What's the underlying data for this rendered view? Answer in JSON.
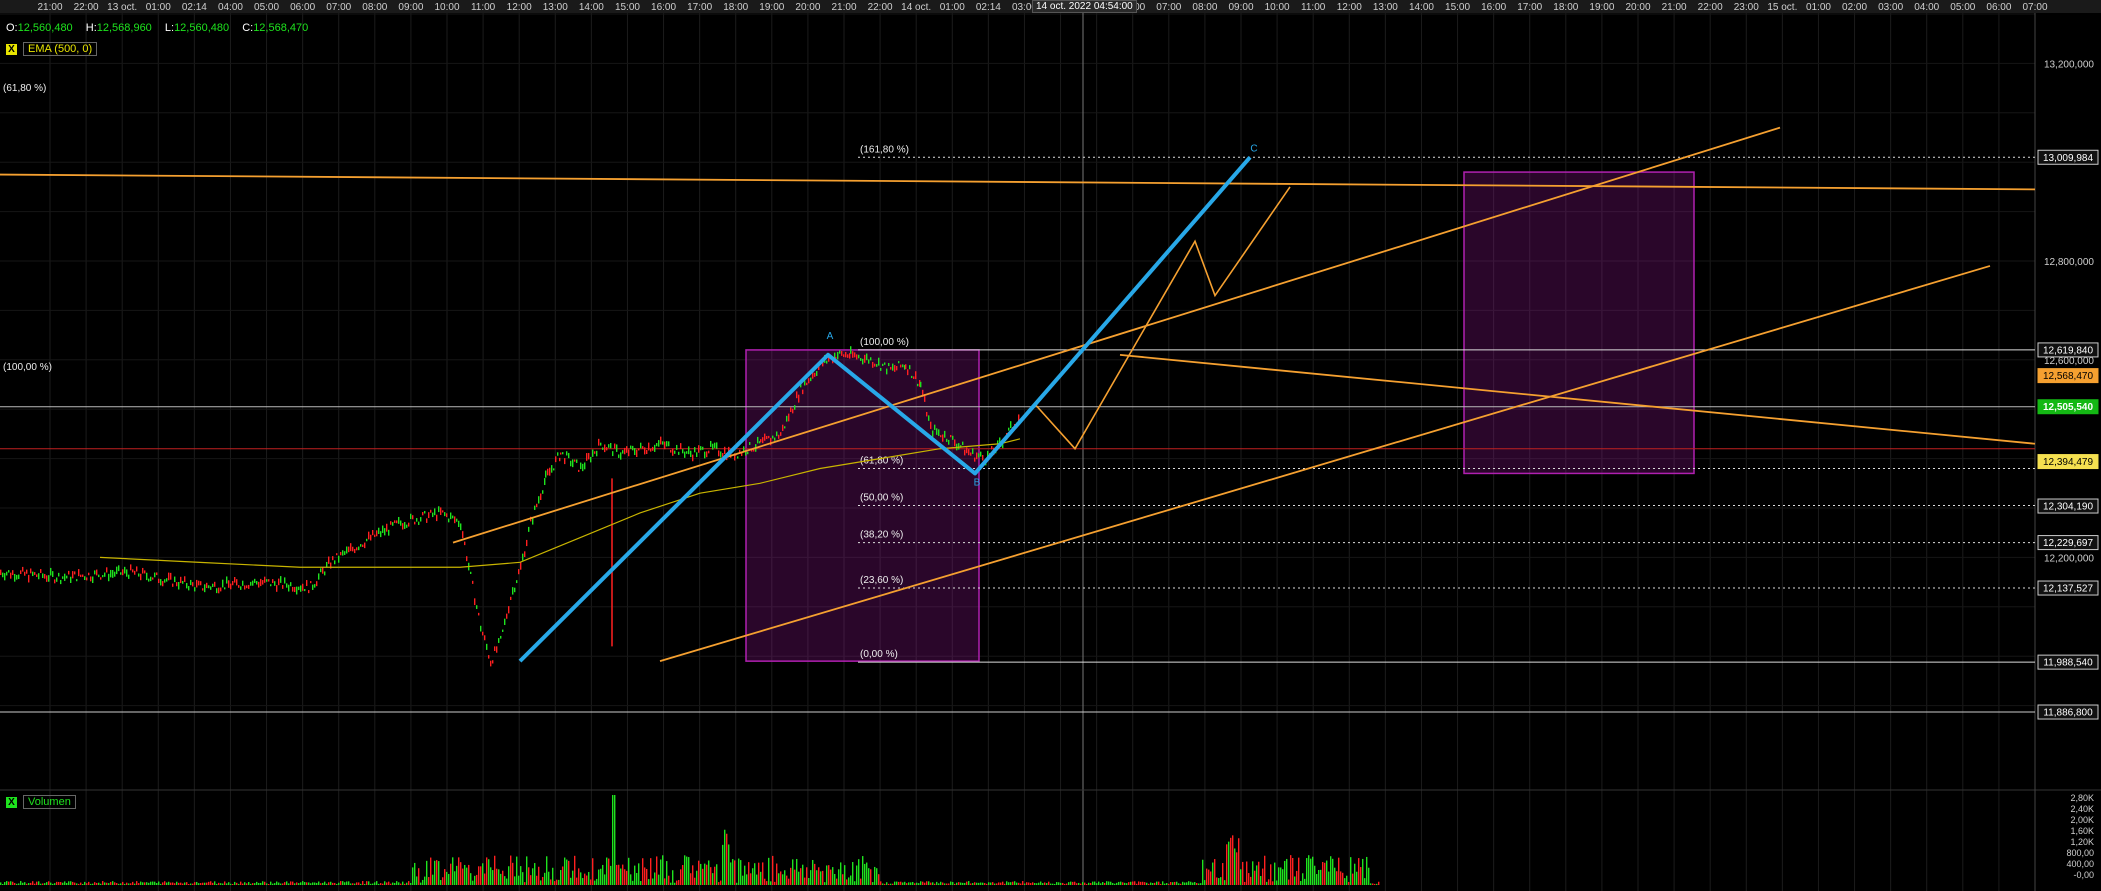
{
  "ohlc": {
    "open_label": "O:",
    "open": "12,560,480",
    "high_label": "H:",
    "high": "12,568,960",
    "low_label": "L:",
    "low": "12,560,480",
    "close_label": "C:",
    "close": "12,568,470"
  },
  "indicator": {
    "toggle": "X",
    "label": "EMA (500, 0)"
  },
  "volume_indicator": {
    "toggle": "X",
    "label": "Volumen"
  },
  "cursor_time": "14 oct. 2022 04:54:00",
  "chart_data": {
    "type": "line",
    "time_ticks": [
      "21:00",
      "22:00",
      "13 oct.",
      "01:00",
      "02:14",
      "04:00",
      "05:00",
      "06:00",
      "07:00",
      "08:00",
      "09:00",
      "10:00",
      "11:00",
      "12:00",
      "13:00",
      "14:00",
      "15:00",
      "16:00",
      "17:00",
      "18:00",
      "19:00",
      "20:00",
      "21:00",
      "22:00",
      "14 oct.",
      "01:00",
      "02:14",
      "03:00",
      "04:00",
      "05:00",
      "06:00",
      "07:00",
      "08:00",
      "09:00",
      "10:00",
      "11:00",
      "12:00",
      "13:00",
      "14:00",
      "15:00",
      "16:00",
      "17:00",
      "18:00",
      "19:00",
      "20:00",
      "21:00",
      "22:00",
      "23:00",
      "15 oct.",
      "01:00",
      "02:00",
      "03:00",
      "04:00",
      "05:00",
      "06:00",
      "07:00"
    ],
    "price_axis": {
      "ticks": [
        "13,200,000",
        "12,800,000",
        "12,600,000",
        "12,200,000"
      ],
      "ylim": [
        11.8,
        13.3
      ]
    },
    "price_tags": [
      {
        "label": "13,009,984",
        "style": "white"
      },
      {
        "label": "12,619,840",
        "style": "white"
      },
      {
        "label": "12,568,470",
        "style": "orange"
      },
      {
        "label": "12,505,540",
        "style": "green"
      },
      {
        "label": "12,394,479",
        "style": "yellow"
      },
      {
        "label": "12,304,190",
        "style": "white"
      },
      {
        "label": "12,229,697",
        "style": "white"
      },
      {
        "label": "12,137,527",
        "style": "white"
      },
      {
        "label": "11,988,540",
        "style": "white"
      },
      {
        "label": "11,886,800",
        "style": "white"
      }
    ],
    "fib_levels": [
      {
        "label": "(161,80 %)",
        "value": 13.01
      },
      {
        "label": "(100,00 %)",
        "value": 12.62
      },
      {
        "label": "(61,80 %)",
        "value": 12.38
      },
      {
        "label": "(50,00 %)",
        "value": 12.305
      },
      {
        "label": "(38,20 %)",
        "value": 12.23
      },
      {
        "label": "(23,60 %)",
        "value": 12.138
      },
      {
        "label": "(0,00 %)",
        "value": 11.988
      }
    ],
    "left_fib_labels": [
      "(61,80 %)",
      "(100,00 %)"
    ],
    "price_series": [
      [
        0,
        12.17
      ],
      [
        60,
        12.16
      ],
      [
        130,
        12.17
      ],
      [
        200,
        12.14
      ],
      [
        260,
        12.15
      ],
      [
        310,
        12.14
      ],
      [
        330,
        12.19
      ],
      [
        370,
        12.24
      ],
      [
        400,
        12.27
      ],
      [
        440,
        12.29
      ],
      [
        460,
        12.27
      ],
      [
        470,
        12.16
      ],
      [
        480,
        12.06
      ],
      [
        490,
        11.99
      ],
      [
        500,
        12.03
      ],
      [
        510,
        12.12
      ],
      [
        520,
        12.18
      ],
      [
        530,
        12.27
      ],
      [
        545,
        12.36
      ],
      [
        560,
        12.41
      ],
      [
        580,
        12.38
      ],
      [
        600,
        12.43
      ],
      [
        620,
        12.41
      ],
      [
        640,
        12.42
      ],
      [
        660,
        12.43
      ],
      [
        690,
        12.41
      ],
      [
        710,
        12.42
      ],
      [
        735,
        12.41
      ],
      [
        760,
        12.43
      ],
      [
        780,
        12.45
      ],
      [
        800,
        12.54
      ],
      [
        820,
        12.59
      ],
      [
        835,
        12.61
      ],
      [
        850,
        12.61
      ],
      [
        870,
        12.6
      ],
      [
        890,
        12.58
      ],
      [
        905,
        12.59
      ],
      [
        920,
        12.55
      ],
      [
        930,
        12.46
      ],
      [
        950,
        12.44
      ],
      [
        970,
        12.41
      ],
      [
        985,
        12.4
      ],
      [
        1000,
        12.43
      ],
      [
        1010,
        12.46
      ],
      [
        1020,
        12.49
      ]
    ],
    "ema_series": [
      [
        100,
        12.2
      ],
      [
        200,
        12.19
      ],
      [
        300,
        12.18
      ],
      [
        400,
        12.18
      ],
      [
        460,
        12.18
      ],
      [
        520,
        12.19
      ],
      [
        580,
        12.24
      ],
      [
        640,
        12.29
      ],
      [
        700,
        12.33
      ],
      [
        760,
        12.35
      ],
      [
        820,
        12.38
      ],
      [
        880,
        12.4
      ],
      [
        940,
        12.42
      ],
      [
        1000,
        12.43
      ],
      [
        1020,
        12.44
      ]
    ],
    "abc_pattern": {
      "labels": [
        "A",
        "B",
        "C"
      ],
      "points": [
        [
          520,
          11.99
        ],
        [
          828,
          12.61
        ],
        [
          975,
          12.37
        ],
        [
          1250,
          13.01
        ]
      ]
    },
    "projection": [
      [
        1035,
        12.51
      ],
      [
        1075,
        12.42
      ],
      [
        1195,
        12.84
      ],
      [
        1215,
        12.73
      ],
      [
        1290,
        12.95
      ]
    ],
    "volume_axis": [
      "2,80K",
      "2,40K",
      "2,00K",
      "1,60K",
      "1,20K",
      "800,00",
      "400,00",
      "-0,00"
    ],
    "colors": {
      "up": "#1ee31e",
      "down": "#ff2020",
      "abc": "#28a8e8",
      "trend": "#f5a030",
      "zone": "#b020b0",
      "ema": "#c8b400"
    }
  }
}
